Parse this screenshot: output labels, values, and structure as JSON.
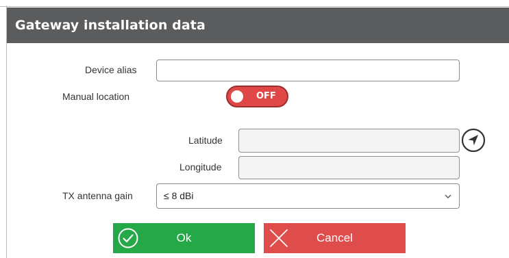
{
  "dialog": {
    "title": "Gateway installation data"
  },
  "form": {
    "device_alias": {
      "label": "Device alias",
      "value": ""
    },
    "manual_location": {
      "label": "Manual location",
      "state": "OFF"
    },
    "latitude": {
      "label": "Latitude",
      "value": ""
    },
    "longitude": {
      "label": "Longitude",
      "value": ""
    },
    "tx_antenna_gain": {
      "label": "TX antenna gain",
      "selected": "≤ 8 dBi"
    }
  },
  "buttons": {
    "ok_label": "Ok",
    "cancel_label": "Cancel"
  },
  "colors": {
    "header_bg": "#5b5c5e",
    "toggle_off": "#e04848",
    "ok_green": "#24a848",
    "cancel_red": "#df4c4c"
  },
  "icons": {
    "locate": "navigation-arrow-icon",
    "ok": "check-circle-icon",
    "cancel": "close-x-icon",
    "dropdown": "chevron-down-icon"
  }
}
